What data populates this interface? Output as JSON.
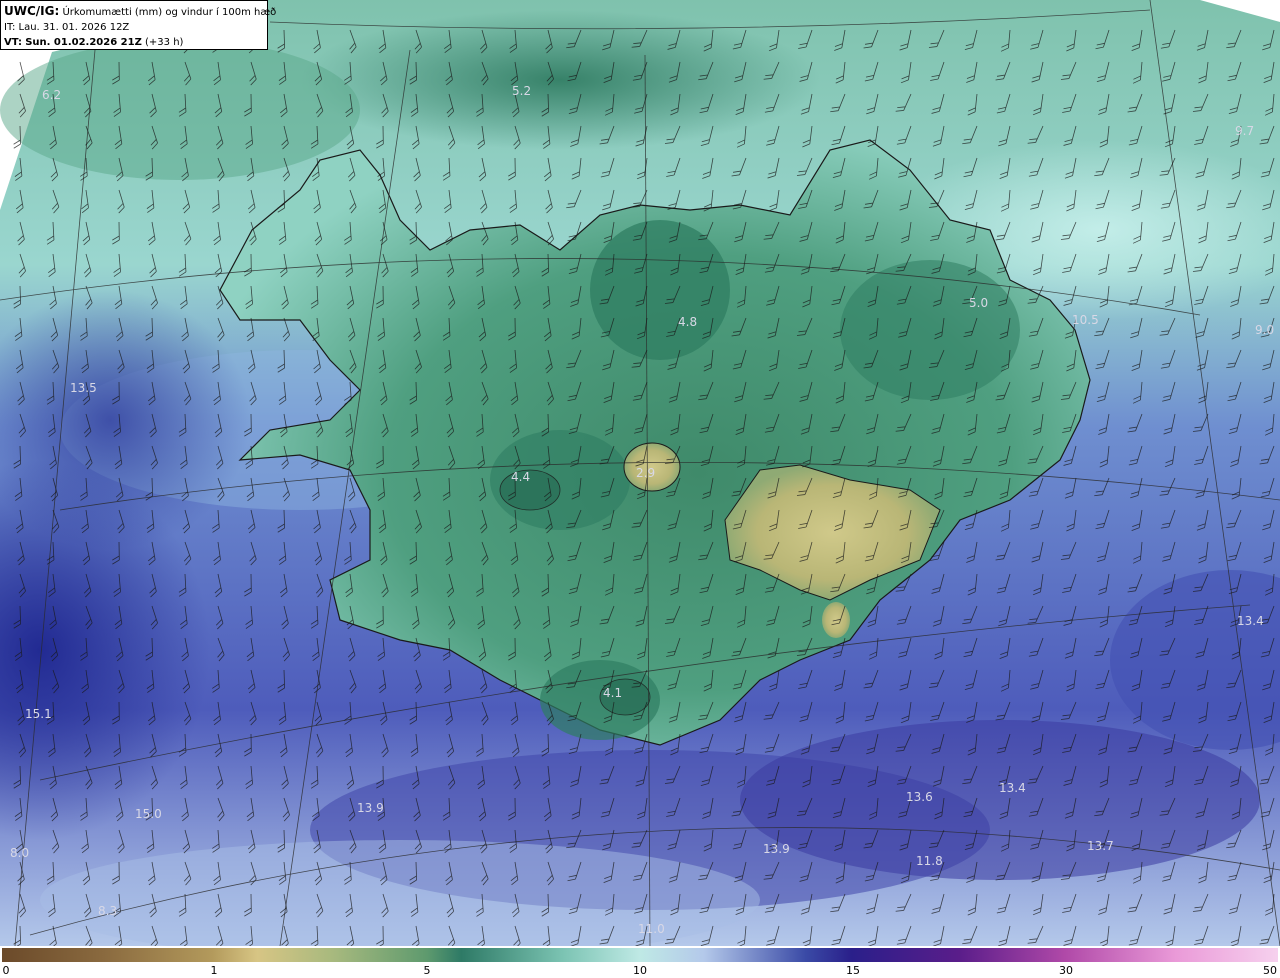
{
  "header": {
    "model": "UWC/IG:",
    "title": "Úrkomumætti (mm) og vindur í 100m hæð",
    "init_label": "IT:",
    "init_time": "Lau. 31. 01. 2026 12Z",
    "valid_label": "VT:",
    "valid_time": "Sun. 01.02.2026 21Z",
    "lead": "(+33 h)"
  },
  "map_labels": [
    "6.2",
    "5.2",
    "9.7",
    "5.0",
    "4.8",
    "10.5",
    "9.0",
    "13.5",
    "4.4",
    "2.9",
    "13.4",
    "15.1",
    "4.1",
    "15.0",
    "13.9",
    "13.6",
    "13.4",
    "13.9",
    "11.8",
    "13.7",
    "8.0",
    "8.3",
    "11.0"
  ],
  "colorbar": {
    "ticks": [
      "0",
      "1",
      "5",
      "10",
      "15",
      "30",
      "50"
    ]
  },
  "colors": {
    "ocean_deep": "#2a2f9a",
    "ocean_mid": "#4b5fbd",
    "ocean_light": "#a9c6e8",
    "teal": "#5fb3a2",
    "green": "#2f7d64",
    "khaki": "#c2bf7a",
    "coast": "#1a1a1a"
  }
}
